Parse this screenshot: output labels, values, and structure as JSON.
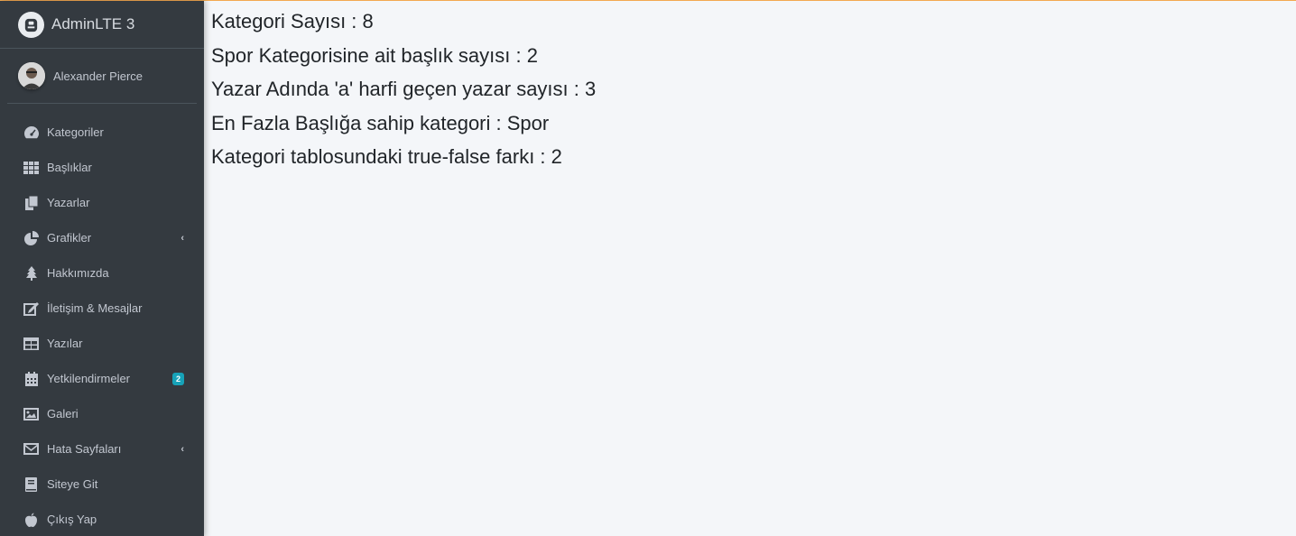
{
  "brand": {
    "title": "AdminLTE 3",
    "logo_icon": "adminlte-logo-icon"
  },
  "user": {
    "name": "Alexander Pierce"
  },
  "nav": {
    "items": [
      {
        "label": "Kategoriler",
        "icon": "tachometer-icon"
      },
      {
        "label": "Başlıklar",
        "icon": "grid-icon"
      },
      {
        "label": "Yazarlar",
        "icon": "copy-icon"
      },
      {
        "label": "Grafikler",
        "icon": "pie-chart-icon",
        "chevron": "‹"
      },
      {
        "label": "Hakkımızda",
        "icon": "tree-icon"
      },
      {
        "label": "İletişim & Mesajlar",
        "icon": "edit-icon"
      },
      {
        "label": "Yazılar",
        "icon": "table-icon"
      },
      {
        "label": "Yetkilendirmeler",
        "icon": "calendar-icon",
        "badge": "2"
      },
      {
        "label": "Galeri",
        "icon": "image-icon"
      },
      {
        "label": "Hata Sayfaları",
        "icon": "envelope-icon",
        "chevron": "‹"
      },
      {
        "label": "Siteye Git",
        "icon": "book-icon"
      },
      {
        "label": "Çıkış Yap",
        "icon": "apple-icon"
      }
    ]
  },
  "stats": [
    "Kategori Sayısı : 8",
    "Spor Kategorisine ait başlık sayısı : 2",
    "Yazar Adında 'a' harfi geçen yazar sayısı : 3",
    "En Fazla Başlığa sahip kategori : Spor",
    "Kategori tablosundaki true-false farkı : 2"
  ],
  "colors": {
    "sidebar_bg": "#343a40",
    "content_bg": "#f4f6f9",
    "badge_bg": "#17a2b8",
    "top_border": "#f3a951"
  }
}
